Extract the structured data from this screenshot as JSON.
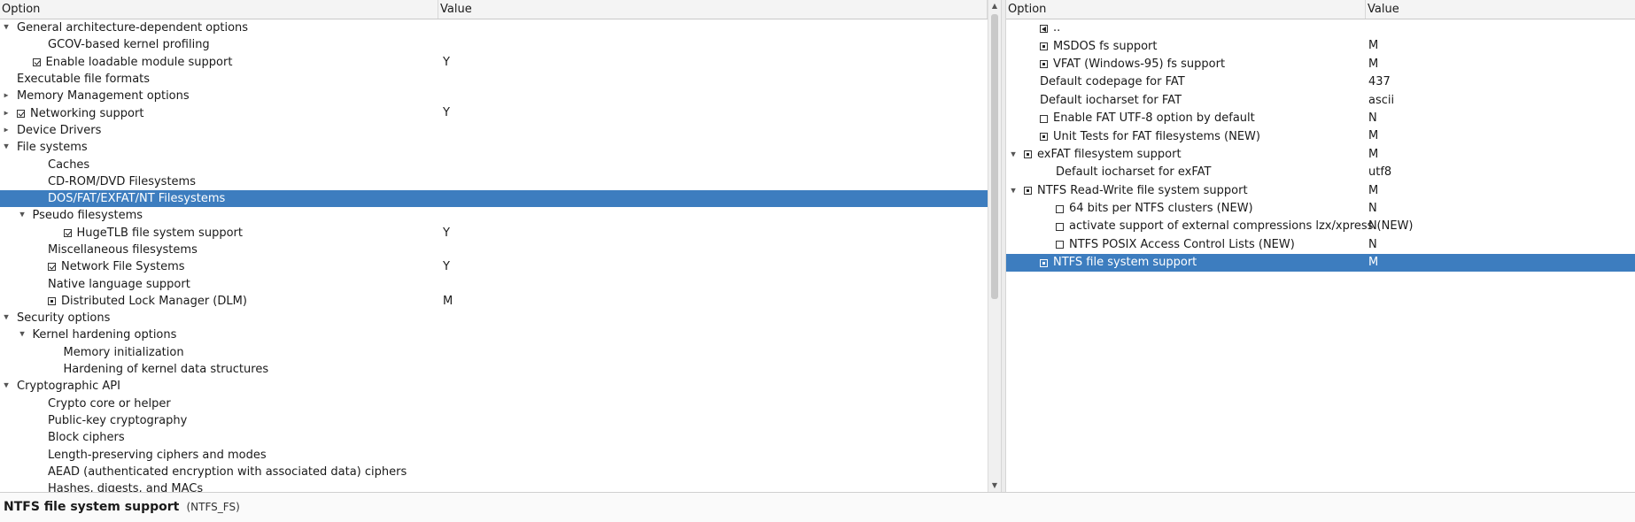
{
  "left_tree": {
    "header": {
      "option": "Option",
      "value": "Value"
    },
    "rows": [
      {
        "label": "General architecture-dependent options",
        "value": "",
        "depth": 0,
        "arrow": "down",
        "box": "none"
      },
      {
        "label": "GCOV-based kernel profiling",
        "value": "",
        "depth": 2,
        "arrow": "none",
        "box": "none"
      },
      {
        "label": "Enable loadable module support",
        "value": "Y",
        "depth": 1,
        "arrow": "none",
        "box": "checked"
      },
      {
        "label": "Executable file formats",
        "value": "",
        "depth": 0,
        "arrow": "none",
        "box": "none"
      },
      {
        "label": "Memory Management options",
        "value": "",
        "depth": 0,
        "arrow": "right",
        "box": "none"
      },
      {
        "label": "Networking support",
        "value": "Y",
        "depth": 0,
        "arrow": "right",
        "box": "checked"
      },
      {
        "label": "Device Drivers",
        "value": "",
        "depth": 0,
        "arrow": "right",
        "box": "none"
      },
      {
        "label": "File systems",
        "value": "",
        "depth": 0,
        "arrow": "down",
        "box": "none"
      },
      {
        "label": "Caches",
        "value": "",
        "depth": 2,
        "arrow": "none",
        "box": "none"
      },
      {
        "label": "CD-ROM/DVD Filesystems",
        "value": "",
        "depth": 2,
        "arrow": "none",
        "box": "none"
      },
      {
        "label": "DOS/FAT/EXFAT/NT Filesystems",
        "value": "",
        "depth": 2,
        "arrow": "none",
        "box": "none",
        "selected": true
      },
      {
        "label": "Pseudo filesystems",
        "value": "",
        "depth": 1,
        "arrow": "down",
        "box": "none"
      },
      {
        "label": "HugeTLB file system support",
        "value": "Y",
        "depth": 3,
        "arrow": "none",
        "box": "checked"
      },
      {
        "label": "Miscellaneous filesystems",
        "value": "",
        "depth": 2,
        "arrow": "none",
        "box": "none"
      },
      {
        "label": "Network File Systems",
        "value": "Y",
        "depth": 2,
        "arrow": "none",
        "box": "checked"
      },
      {
        "label": "Native language support",
        "value": "",
        "depth": 2,
        "arrow": "none",
        "box": "none"
      },
      {
        "label": "Distributed Lock Manager (DLM)",
        "value": "M",
        "depth": 2,
        "arrow": "none",
        "box": "module"
      },
      {
        "label": "Security options",
        "value": "",
        "depth": 0,
        "arrow": "down",
        "box": "none"
      },
      {
        "label": "Kernel hardening options",
        "value": "",
        "depth": 1,
        "arrow": "down",
        "box": "none"
      },
      {
        "label": "Memory initialization",
        "value": "",
        "depth": 3,
        "arrow": "none",
        "box": "none"
      },
      {
        "label": "Hardening of kernel data structures",
        "value": "",
        "depth": 3,
        "arrow": "none",
        "box": "none"
      },
      {
        "label": "Cryptographic API",
        "value": "",
        "depth": 0,
        "arrow": "down",
        "box": "none"
      },
      {
        "label": "Crypto core or helper",
        "value": "",
        "depth": 2,
        "arrow": "none",
        "box": "none"
      },
      {
        "label": "Public-key cryptography",
        "value": "",
        "depth": 2,
        "arrow": "none",
        "box": "none"
      },
      {
        "label": "Block ciphers",
        "value": "",
        "depth": 2,
        "arrow": "none",
        "box": "none"
      },
      {
        "label": "Length-preserving ciphers and modes",
        "value": "",
        "depth": 2,
        "arrow": "none",
        "box": "none"
      },
      {
        "label": "AEAD (authenticated encryption with associated data) ciphers",
        "value": "",
        "depth": 2,
        "arrow": "none",
        "box": "none"
      },
      {
        "label": "Hashes, digests, and MACs",
        "value": "",
        "depth": 2,
        "arrow": "none",
        "box": "none"
      }
    ]
  },
  "right_list": {
    "header": {
      "option": "Option",
      "value": "Value"
    },
    "rows": [
      {
        "label": "..",
        "value": "",
        "depth": 1,
        "arrow": "none",
        "box": "back"
      },
      {
        "label": "MSDOS fs support",
        "value": "M",
        "depth": 1,
        "arrow": "none",
        "box": "module"
      },
      {
        "label": "VFAT (Windows-95) fs support",
        "value": "M",
        "depth": 1,
        "arrow": "none",
        "box": "module"
      },
      {
        "label": "Default codepage for FAT",
        "value": "437",
        "depth": 1,
        "arrow": "none",
        "box": "none"
      },
      {
        "label": "Default iocharset for FAT",
        "value": "ascii",
        "depth": 1,
        "arrow": "none",
        "box": "none"
      },
      {
        "label": "Enable FAT UTF-8 option by default",
        "value": "N",
        "depth": 1,
        "arrow": "none",
        "box": "empty"
      },
      {
        "label": "Unit Tests for FAT filesystems (NEW)",
        "value": "M",
        "depth": 1,
        "arrow": "none",
        "box": "module"
      },
      {
        "label": "exFAT filesystem support",
        "value": "M",
        "depth": 0,
        "arrow": "down",
        "box": "module"
      },
      {
        "label": "Default iocharset for exFAT",
        "value": "utf8",
        "depth": 2,
        "arrow": "none",
        "box": "none"
      },
      {
        "label": "NTFS Read-Write file system support",
        "value": "M",
        "depth": 0,
        "arrow": "down",
        "box": "module"
      },
      {
        "label": "64 bits per NTFS clusters (NEW)",
        "value": "N",
        "depth": 2,
        "arrow": "none",
        "box": "empty"
      },
      {
        "label": "activate support of external compressions lzx/xpress (NEW)",
        "value": "N",
        "depth": 2,
        "arrow": "none",
        "box": "empty"
      },
      {
        "label": "NTFS POSIX Access Control Lists (NEW)",
        "value": "N",
        "depth": 2,
        "arrow": "none",
        "box": "empty"
      },
      {
        "label": "NTFS file system support",
        "value": "M",
        "depth": 1,
        "arrow": "none",
        "box": "module",
        "selected": true
      }
    ]
  },
  "status": {
    "title": "NTFS file system support",
    "symbol": "(NTFS_FS)"
  },
  "colors": {
    "selection": "#3d7dbf",
    "header_bg": "#f4f4f4"
  }
}
